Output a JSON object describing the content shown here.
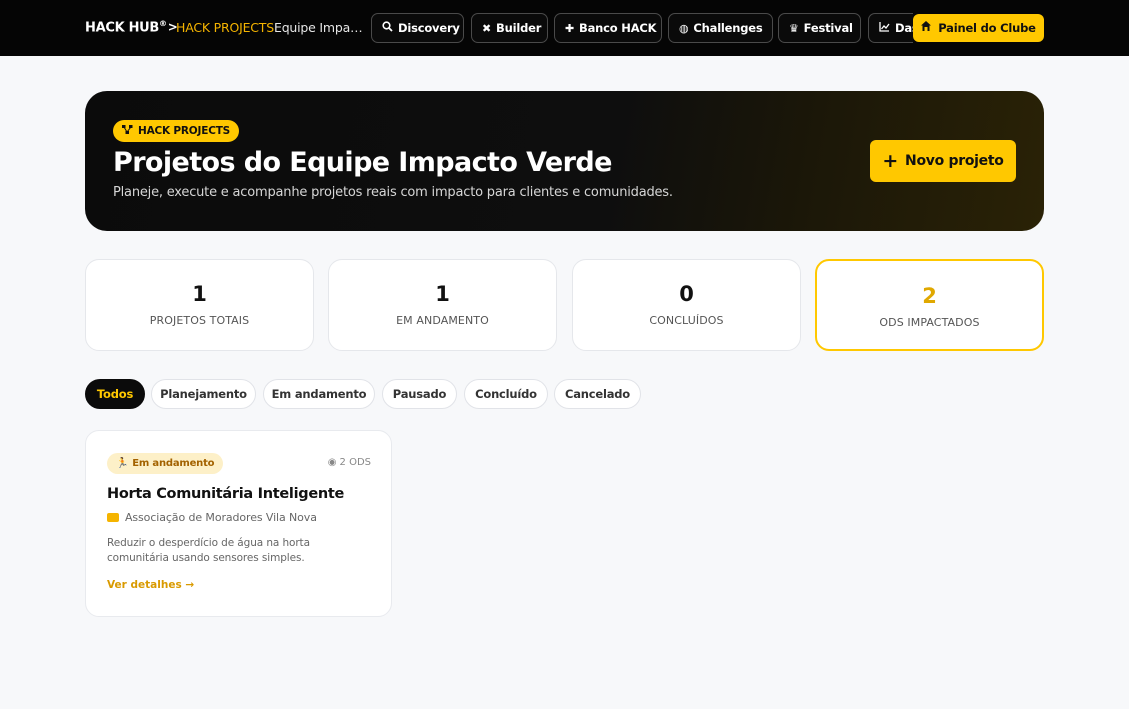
{
  "header": {
    "brand": "HACK HUB",
    "brand_mark": "®",
    "separator": ">",
    "breadcrumb_section": "HACK PROJECTS",
    "breadcrumb_team": "Equipe Impacto Verde",
    "nav": [
      {
        "label": "Discovery",
        "icon": "search-icon"
      },
      {
        "label": "Builder",
        "icon": "tools-icon"
      },
      {
        "label": "Banco HACK",
        "icon": "puzzle-icon"
      },
      {
        "label": "Challenges",
        "icon": "handshake-icon"
      },
      {
        "label": "Festival",
        "icon": "trophy-icon"
      },
      {
        "label": "Dashboard",
        "icon": "chart-line-icon"
      }
    ],
    "club_button": "Painel do Clube"
  },
  "hero": {
    "badge": "HACK PROJECTS",
    "title": "Projetos do Equipe Impacto Verde",
    "subtitle": "Planeje, execute e acompanhe projetos reais com impacto para clientes e comunidades.",
    "new_button": "Novo projeto"
  },
  "stats": [
    {
      "value": "1",
      "label": "PROJETOS TOTAIS"
    },
    {
      "value": "1",
      "label": "EM ANDAMENTO"
    },
    {
      "value": "0",
      "label": "CONCLUÍDOS"
    },
    {
      "value": "2",
      "label": "ODS IMPACTADOS"
    }
  ],
  "filters": [
    "Todos",
    "Planejamento",
    "Em andamento",
    "Pausado",
    "Concluído",
    "Cancelado"
  ],
  "active_filter": "Todos",
  "projects": [
    {
      "status": "Em andamento",
      "ods": "2 ODS",
      "title": "Horta Comunitária Inteligente",
      "client": "Associação de Moradores Vila Nova",
      "description": "Reduzir o desperdício de água na horta comunitária usando sensores simples.",
      "details_link": "Ver detalhes →"
    }
  ],
  "colors": {
    "accent": "#ffc800",
    "topbar": "#050505",
    "background": "#f7f8fa"
  }
}
